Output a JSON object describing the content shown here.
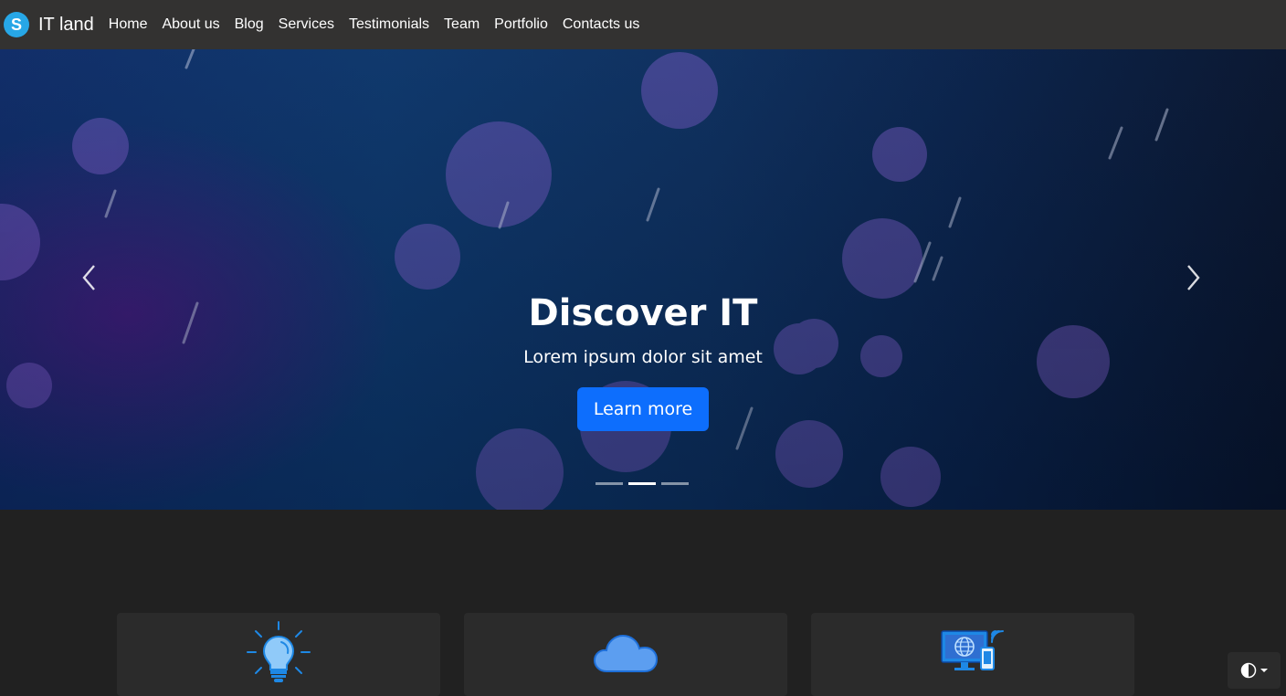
{
  "brand": {
    "logo_letter": "S",
    "name": "IT land",
    "logo_color": "#27a7e7"
  },
  "nav": {
    "items": [
      {
        "label": "Home"
      },
      {
        "label": "About us"
      },
      {
        "label": "Blog"
      },
      {
        "label": "Services"
      },
      {
        "label": "Testimonials"
      },
      {
        "label": "Team"
      },
      {
        "label": "Portfolio"
      },
      {
        "label": "Contacts us"
      }
    ]
  },
  "hero": {
    "title": "Discover IT",
    "subtitle": "Lorem ipsum dolor sit amet",
    "cta_label": "Learn more",
    "cta_color": "#0d6efd",
    "prev_icon": "chevron-left-icon",
    "next_icon": "chevron-right-icon",
    "slides_count": 3,
    "active_slide": 2
  },
  "features": [
    {
      "icon": "lightbulb-icon"
    },
    {
      "icon": "cloud-icon"
    },
    {
      "icon": "computer-phone-icon"
    }
  ],
  "theme_toggle": {
    "icon": "contrast-icon",
    "caret": "caret-down-icon"
  }
}
